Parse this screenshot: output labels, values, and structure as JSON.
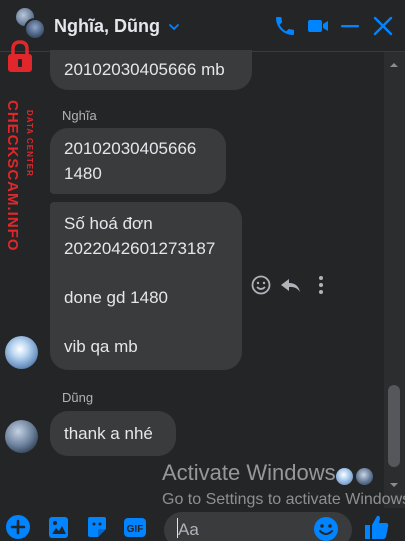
{
  "header": {
    "title": "Nghĩa, Dũng",
    "icons": [
      "phone-icon",
      "video-icon",
      "minimize-icon",
      "close-icon"
    ]
  },
  "watermark": {
    "text": "CHECKSCAM.INFO",
    "subtext": "DATA CENTER",
    "color": "#e1272b"
  },
  "messages": [
    {
      "sender": "",
      "text": "20102030405666 mb"
    },
    {
      "sender": "Nghĩa",
      "text": "20102030405666\n1480"
    },
    {
      "sender": "",
      "text": "Số hoá đơn\n2022042601273187\n\ndone gd 1480\n\nvib qa mb"
    },
    {
      "sender": "Dũng",
      "text": "thank a nhé"
    }
  ],
  "overlay": {
    "activate_title": "Activate Windows",
    "activate_sub": "Go to Settings to activate Windows."
  },
  "composer": {
    "placeholder": "Aa",
    "tools": [
      "add-icon",
      "image-icon",
      "sticker-icon",
      "gif-icon"
    ]
  },
  "colors": {
    "accent": "#0084ff",
    "background": "#242526",
    "bubble": "#3a3b3c"
  }
}
